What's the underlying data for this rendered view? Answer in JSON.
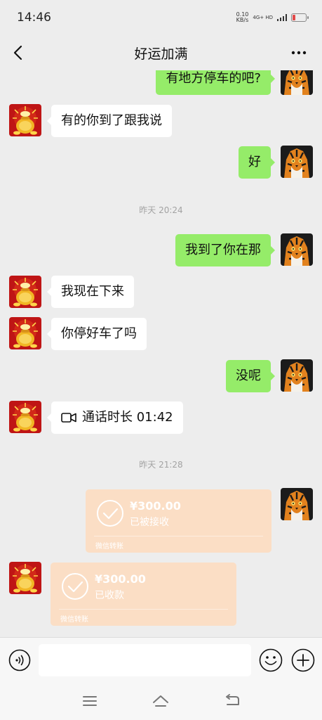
{
  "status_bar": {
    "time": "14:46",
    "net_speed": "0.10",
    "net_unit": "KB/s",
    "network": "4G+ HD"
  },
  "nav": {
    "title": "好运加满"
  },
  "messages": [
    {
      "side": "out",
      "text": "有地方停车的吧?"
    },
    {
      "side": "in",
      "text": "有的你到了跟我说"
    },
    {
      "side": "out",
      "text": "好"
    },
    {
      "type": "timestamp",
      "text": "昨天 20:24"
    },
    {
      "side": "out",
      "text": "我到了你在那"
    },
    {
      "side": "in",
      "text": "我现在下来"
    },
    {
      "side": "in",
      "text": "你停好车了吗"
    },
    {
      "side": "out",
      "text": "没呢"
    },
    {
      "side": "in",
      "type": "call",
      "text": "通话时长 01:42"
    },
    {
      "type": "timestamp",
      "text": "昨天 21:28"
    },
    {
      "side": "out",
      "type": "transfer",
      "amount": "¥300.00",
      "status": "已被接收",
      "label": "微信转账"
    },
    {
      "side": "in",
      "type": "transfer",
      "amount": "¥300.00",
      "status": "已收款",
      "label": "微信转账"
    }
  ],
  "input": {
    "placeholder": ""
  },
  "colors": {
    "background": "#ededed",
    "outgoing_bubble": "#95ec69",
    "incoming_bubble": "#ffffff",
    "transfer_card": "#fbdec5",
    "timestamp_text": "#a3a3a3"
  },
  "icons": {
    "back": "chevron-left-icon",
    "more": "ellipsis-icon",
    "voice": "voice-icon",
    "emoji": "emoji-icon",
    "plus": "plus-icon",
    "call": "video-camera-icon",
    "transfer": "checkmark-circle-icon",
    "sys_menu": "menu-icon",
    "sys_home": "home-icon",
    "sys_back": "back-icon"
  }
}
